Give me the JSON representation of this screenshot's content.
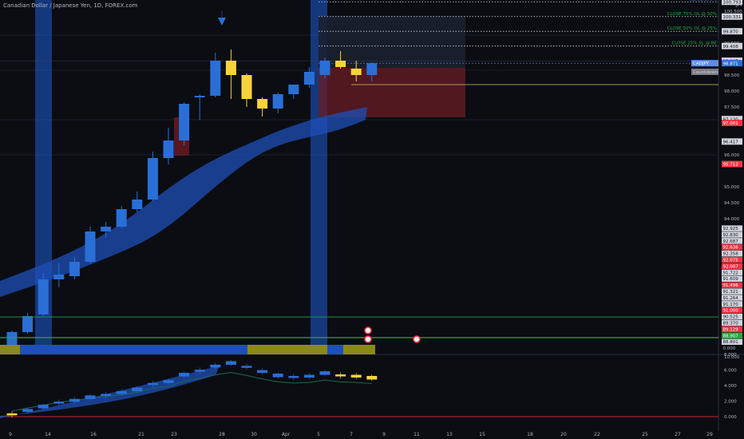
{
  "header": {
    "symbol_title": "Canadian Dollar / Japanese Yen, 1D, FOREX.com"
  },
  "price_axis": {
    "currency": "JPY",
    "ylim": [
      89.8,
      101.0
    ],
    "ticks": [
      {
        "v": 98.5,
        "t": "98.500"
      },
      {
        "v": 98.0,
        "t": "98.000"
      },
      {
        "v": 97.5,
        "t": "97.500"
      },
      {
        "v": 96.0,
        "t": "96.000"
      },
      {
        "v": 95.0,
        "t": "95.000"
      },
      {
        "v": 94.5,
        "t": "94.500"
      },
      {
        "v": 94.0,
        "t": "94.000"
      },
      {
        "v": 93.5,
        "t": "93.500"
      },
      {
        "v": 93.0,
        "t": "93.000"
      }
    ],
    "top_ticks": [
      {
        "v": 100.5,
        "t": "100.500"
      },
      {
        "v": 99.5,
        "t": "99.500"
      },
      {
        "v": 99.0,
        "t": "99.000"
      }
    ],
    "tags": [
      {
        "v": 100.793,
        "t": "100.793",
        "bg": "#d1d4dc",
        "fg": "#131722"
      },
      {
        "v": 100.331,
        "t": "100.331",
        "bg": "#d1d4dc",
        "fg": "#131722"
      },
      {
        "v": 99.87,
        "t": "99.870",
        "bg": "#d1d4dc",
        "fg": "#131722"
      },
      {
        "v": 99.408,
        "t": "99.408",
        "bg": "#d1d4dc",
        "fg": "#131722"
      },
      {
        "v": 98.947,
        "t": "98.947",
        "bg": "#d1d4dc",
        "fg": "#131722"
      },
      {
        "v": 98.871,
        "t": "98.871",
        "bg": "#2a6fd6",
        "fg": "#ffffff"
      },
      {
        "v": 97.12,
        "t": "97.120",
        "bg": "#d1d4dc",
        "fg": "#131722"
      },
      {
        "v": 97.001,
        "t": "97.001",
        "bg": "#f23645",
        "fg": "#ffffff"
      },
      {
        "v": 96.417,
        "t": "96.417",
        "bg": "#d1d4dc",
        "fg": "#131722"
      },
      {
        "v": 95.712,
        "t": "95.712",
        "bg": "#f23645",
        "fg": "#ffffff"
      }
    ],
    "symbol_tag": "CADJPY",
    "countdown_tag": "Countdown"
  },
  "lower_axis": {
    "tags": [
      {
        "t": "92.925",
        "bg": "#d1d4dc",
        "fg": "#131722"
      },
      {
        "t": "92.830",
        "bg": "#d1d4dc",
        "fg": "#131722"
      },
      {
        "t": "92.687",
        "bg": "#d1d4dc",
        "fg": "#131722"
      },
      {
        "t": "92.636",
        "bg": "#f23645",
        "fg": "#ffffff"
      },
      {
        "t": "92.358",
        "bg": "#d1d4dc",
        "fg": "#131722"
      },
      {
        "t": "92.075",
        "bg": "#f23645",
        "fg": "#ffffff"
      },
      {
        "t": "92.007",
        "bg": "#f23645",
        "fg": "#ffffff"
      },
      {
        "t": "91.722",
        "bg": "#d1d4dc",
        "fg": "#131722"
      },
      {
        "t": "91.609",
        "bg": "#d1d4dc",
        "fg": "#131722"
      },
      {
        "t": "91.496",
        "bg": "#f23645",
        "fg": "#ffffff"
      },
      {
        "t": "91.321",
        "bg": "#d1d4dc",
        "fg": "#131722"
      },
      {
        "t": "91.264",
        "bg": "#d1d4dc",
        "fg": "#131722"
      },
      {
        "t": "91.170",
        "bg": "#d1d4dc",
        "fg": "#131722"
      },
      {
        "t": "91.000",
        "bg": "#f23645",
        "fg": "#ffffff"
      },
      {
        "t": "90.525",
        "bg": "#d1d4dc",
        "fg": "#131722"
      },
      {
        "t": "89.370",
        "bg": "#d1d4dc",
        "fg": "#131722"
      },
      {
        "t": "89.129",
        "bg": "#f23645",
        "fg": "#ffffff"
      },
      {
        "t": "88.907",
        "bg": "#22ab3c",
        "fg": "#ffffff"
      },
      {
        "t": "88.801",
        "bg": "#d1d4dc",
        "fg": "#131722"
      },
      {
        "t": "0.000",
        "bg": "",
        "fg": "#b2b5be"
      }
    ]
  },
  "osc_axis": {
    "ticks": [
      {
        "v": 8,
        "t": "8.000"
      },
      {
        "v": 6,
        "t": "6.000"
      },
      {
        "v": 4,
        "t": "4.000"
      },
      {
        "v": 2,
        "t": "2.000"
      },
      {
        "v": 0,
        "t": "0.000"
      }
    ],
    "top_label": "10.000"
  },
  "trade_levels": [
    {
      "label": "CLOSE 100%",
      "v": 100.793,
      "color": "#5b8def"
    },
    {
      "label": "CLOSE 75% OL @ 50%",
      "v": 100.331,
      "color": "#22ab3c"
    },
    {
      "label": "CLOSE 50% OL @ 25%",
      "v": 99.87,
      "color": "#22ab3c"
    },
    {
      "label": "CLOSE 25% SL @ BE",
      "v": 99.408,
      "color": "#22ab3c"
    }
  ],
  "x_axis": {
    "labels": [
      "9",
      "14",
      "16",
      "21",
      "23",
      "28",
      "30",
      "Apr",
      "5",
      "7",
      "9",
      "11",
      "13",
      "15",
      "18",
      "20",
      "22",
      "25",
      "27",
      "29"
    ]
  },
  "chart_data": {
    "type": "candlestick",
    "title": "Canadian Dollar / Japanese Yen, 1D, FOREX.com",
    "currency": "JPY",
    "ylim": [
      89.8,
      101.0
    ],
    "candles": [
      {
        "o": 89.95,
        "h": 90.5,
        "l": 89.9,
        "c": 90.45,
        "col": "blue"
      },
      {
        "o": 90.45,
        "h": 91.05,
        "l": 90.4,
        "c": 90.95,
        "col": "blue"
      },
      {
        "o": 91.0,
        "h": 92.3,
        "l": 90.95,
        "c": 92.1,
        "col": "blue"
      },
      {
        "o": 92.1,
        "h": 92.6,
        "l": 91.85,
        "c": 92.25,
        "col": "blue"
      },
      {
        "o": 92.2,
        "h": 92.8,
        "l": 92.1,
        "c": 92.65,
        "col": "blue"
      },
      {
        "o": 92.65,
        "h": 93.75,
        "l": 92.6,
        "c": 93.6,
        "col": "blue"
      },
      {
        "o": 93.6,
        "h": 93.9,
        "l": 93.4,
        "c": 93.75,
        "col": "blue"
      },
      {
        "o": 93.75,
        "h": 94.4,
        "l": 93.7,
        "c": 94.3,
        "col": "blue"
      },
      {
        "o": 94.3,
        "h": 94.85,
        "l": 94.2,
        "c": 94.6,
        "col": "blue"
      },
      {
        "o": 94.6,
        "h": 96.1,
        "l": 94.55,
        "c": 95.9,
        "col": "blue"
      },
      {
        "o": 95.9,
        "h": 96.85,
        "l": 95.7,
        "c": 96.45,
        "col": "blue"
      },
      {
        "o": 96.45,
        "h": 97.65,
        "l": 96.3,
        "c": 97.6,
        "col": "blue"
      },
      {
        "o": 97.8,
        "h": 97.9,
        "l": 97.1,
        "c": 97.85,
        "col": "blue"
      },
      {
        "o": 97.85,
        "h": 99.2,
        "l": 97.8,
        "c": 98.95,
        "col": "blue"
      },
      {
        "o": 98.95,
        "h": 99.3,
        "l": 97.75,
        "c": 98.5,
        "col": "yellow"
      },
      {
        "o": 98.5,
        "h": 98.55,
        "l": 97.5,
        "c": 97.75,
        "col": "yellow"
      },
      {
        "o": 97.75,
        "h": 97.8,
        "l": 97.2,
        "c": 97.45,
        "col": "yellow"
      },
      {
        "o": 97.45,
        "h": 97.95,
        "l": 97.3,
        "c": 97.9,
        "col": "blue"
      },
      {
        "o": 97.9,
        "h": 98.15,
        "l": 97.75,
        "c": 98.2,
        "col": "blue"
      },
      {
        "o": 98.2,
        "h": 98.75,
        "l": 98.1,
        "c": 98.6,
        "col": "blue"
      },
      {
        "o": 98.5,
        "h": 99.05,
        "l": 98.4,
        "c": 98.95,
        "col": "blue"
      },
      {
        "o": 98.95,
        "h": 99.25,
        "l": 98.7,
        "c": 98.75,
        "col": "yellow"
      },
      {
        "o": 98.7,
        "h": 98.95,
        "l": 98.3,
        "c": 98.5,
        "col": "yellow"
      },
      {
        "o": 98.5,
        "h": 98.9,
        "l": 98.3,
        "c": 98.87,
        "col": "blue"
      }
    ],
    "levels": [
      {
        "name": "CLOSE 100%",
        "value": 100.793
      },
      {
        "name": "CLOSE 75% OL @ 50%",
        "value": 100.331
      },
      {
        "name": "CLOSE 50% OL @ 25%",
        "value": 99.87
      },
      {
        "name": "CLOSE 25% SL @ BE",
        "value": 99.408
      },
      {
        "name": "",
        "value": 98.947
      },
      {
        "name": "",
        "value": 98.2
      }
    ],
    "last_price": 98.871,
    "oscillator": {
      "ylim": [
        -0.5,
        10.5
      ],
      "values": [
        0.3,
        0.8,
        1.3,
        1.8,
        2.1,
        2.5,
        2.8,
        3.1,
        3.5,
        4.2,
        4.5,
        5.4,
        5.9,
        6.5,
        6.9,
        6.4,
        5.8,
        5.3,
        5.1,
        5.2,
        5.6,
        5.3,
        5.2,
        5.0
      ],
      "baseline": 0.0
    }
  }
}
